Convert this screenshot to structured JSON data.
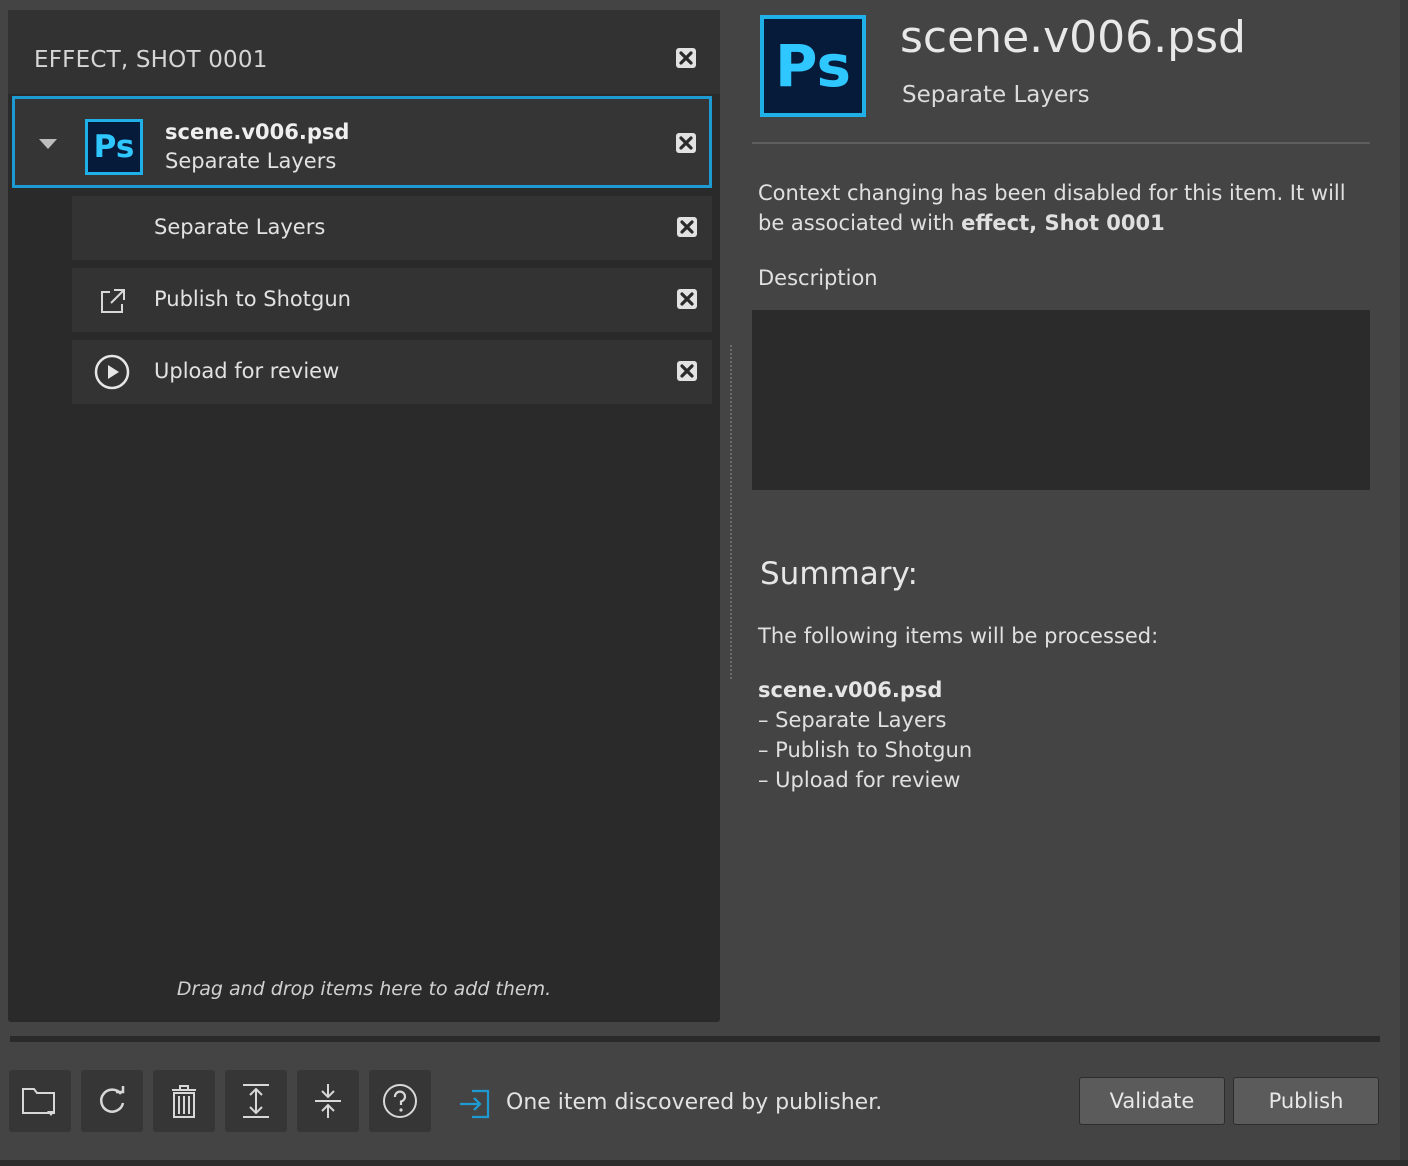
{
  "context": {
    "title": "EFFECT, SHOT 0001"
  },
  "item": {
    "name": "scene.v006.psd",
    "subtitle": "Separate Layers",
    "icon_label": "Ps"
  },
  "tasks": [
    {
      "label": "Separate Layers",
      "icon": "none"
    },
    {
      "label": "Publish to Shotgun",
      "icon": "external-link-icon"
    },
    {
      "label": "Upload for review",
      "icon": "play-circle-icon"
    }
  ],
  "drag_hint": "Drag and drop items here to add them.",
  "details": {
    "icon_label": "Ps",
    "title": "scene.v006.psd",
    "subtitle": "Separate Layers",
    "context_msg_prefix": "Context changing has been disabled for this item. It will be associated with ",
    "context_msg_bold": "effect, Shot 0001",
    "description_label": "Description",
    "description_value": "",
    "summary_title": "Summary:",
    "summary_intro": "The following items will be processed:",
    "summary_item": "scene.v006.psd",
    "summary_tasks": [
      "– Separate Layers",
      "– Publish to Shotgun",
      "– Upload for review"
    ]
  },
  "toolbar": {
    "status_text": "One item discovered by publisher.",
    "validate_label": "Validate",
    "publish_label": "Publish"
  },
  "colors": {
    "accent": "#1e9ad3",
    "ps_blue": "#2ec7ff",
    "ps_bg": "#061b3a"
  }
}
